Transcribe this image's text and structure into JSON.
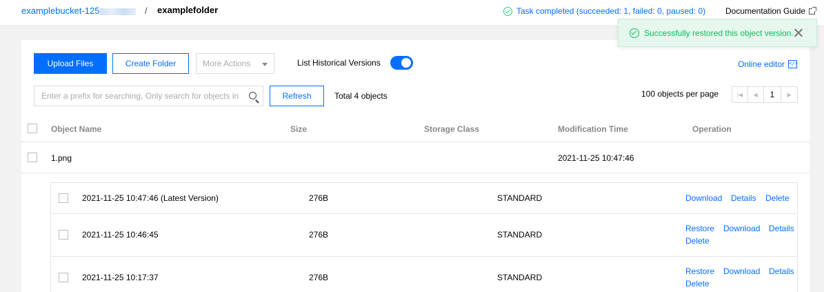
{
  "breadcrumb": {
    "bucket": "examplebucket-125",
    "separator": "/",
    "folder": "examplefolder"
  },
  "task_status": "Task completed (succeeded: 1, failed: 0, paused: 0)",
  "documentation_guide": "Documentation Guide",
  "toast": {
    "message": "Successfully restored this object version."
  },
  "toolbar": {
    "upload_label": "Upload Files",
    "create_folder_label": "Create Folder",
    "more_actions_label": "More Actions",
    "historical_versions_label": "List Historical Versions",
    "historical_versions_on": true,
    "online_editor_label": "Online editor"
  },
  "search": {
    "placeholder": "Enter a prefix for searching, Only search for objects in th",
    "value": ""
  },
  "refresh_label": "Refresh",
  "total_label": "Total 4 objects",
  "pagination": {
    "per_page_label": "100 objects per page",
    "current_page": "1"
  },
  "table": {
    "headers": [
      "Object Name",
      "Size",
      "Storage Class",
      "Modification Time",
      "Operation"
    ],
    "rows": [
      {
        "name": "1.png",
        "size": "",
        "storage_class": "",
        "modified": "2021-11-25 10:47:46"
      }
    ]
  },
  "versions": [
    {
      "name": "2021-11-25 10:47:46 (Latest Version)",
      "size": "276B",
      "storage_class": "STANDARD",
      "actions": [
        "Download",
        "Details",
        "Delete"
      ]
    },
    {
      "name": "2021-11-25 10:46:45",
      "size": "276B",
      "storage_class": "STANDARD",
      "actions": [
        "Restore",
        "Download",
        "Details",
        "Delete"
      ]
    },
    {
      "name": "2021-11-25 10:17:37",
      "size": "276B",
      "storage_class": "STANDARD",
      "actions": [
        "Restore",
        "Download",
        "Details",
        "Delete"
      ]
    }
  ],
  "colors": {
    "primary": "#006eff",
    "success": "#0abf5b",
    "toast_bg": "#e6f7ee"
  }
}
